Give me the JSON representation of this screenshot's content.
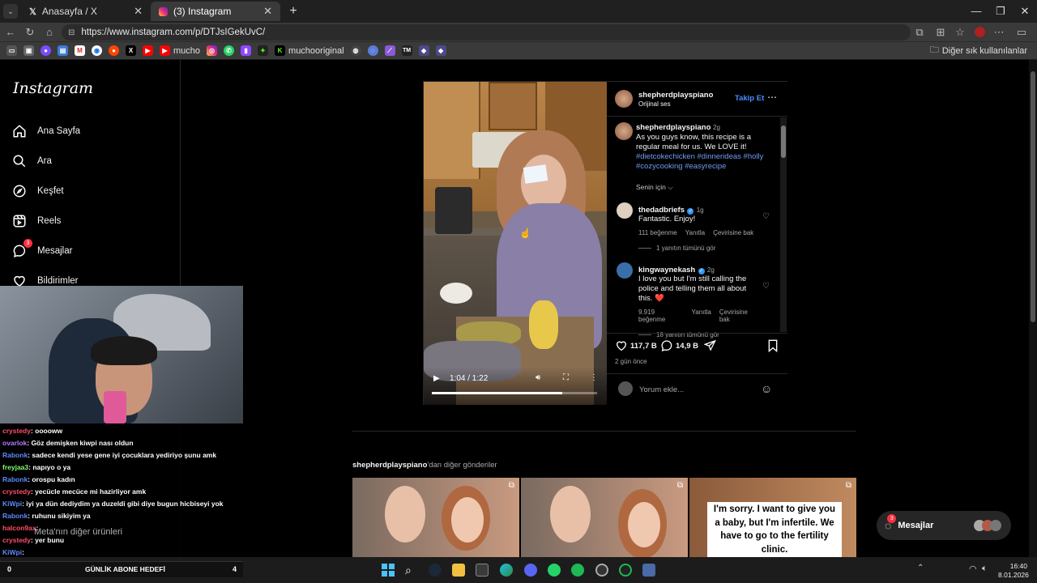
{
  "browser": {
    "tabs": [
      {
        "title": "Anasayfa / X",
        "icon": "x-logo-icon"
      },
      {
        "title": "(3) Instagram",
        "icon": "instagram-logo-icon"
      }
    ],
    "url": "https://www.instagram.com/p/DTJsIGekUvC/",
    "bookmarks": [
      "mucho",
      "muchooriginal"
    ],
    "bookmarks_other": "Diğer sık kullanılanlar"
  },
  "instagram": {
    "logo": "Instagram",
    "nav": [
      {
        "label": "Ana Sayfa",
        "icon": "home-icon"
      },
      {
        "label": "Ara",
        "icon": "search-icon"
      },
      {
        "label": "Keşfet",
        "icon": "compass-icon"
      },
      {
        "label": "Reels",
        "icon": "reels-icon"
      },
      {
        "label": "Mesajlar",
        "icon": "messenger-icon",
        "badge": "3"
      },
      {
        "label": "Bildirimler",
        "icon": "heart-icon"
      }
    ],
    "more_label": "Meta'nın diğer ürünleri",
    "post": {
      "author": "shepherdplayspiano",
      "audio": "Orijinal ses",
      "follow": "Takip Et",
      "caption_time": "2g",
      "caption": "As you guys know, this recipe is a regular meal for us. We LOVE it!",
      "hashtags": "#dietcokechicken #dinnerideas #holly #cozycooking #easyrecipe",
      "for_you": "Senin için",
      "video_time": "1:04 / 1:22",
      "video_progress": 0.79,
      "comments": [
        {
          "user": "thedadbriefs",
          "verified": true,
          "time": "1g",
          "text": "Fantastic. Enjoy!",
          "likes": "111 beğenme",
          "reply": "Yanıtla",
          "translate": "Çevirisine bak",
          "replies": "1 yanıtın tümünü gör"
        },
        {
          "user": "kingwaynekash",
          "verified": true,
          "time": "2g",
          "text": "I love you but I'm still calling the police and telling them all about this. ❤️",
          "likes": "9.919 beğenme",
          "reply": "Yanıtla",
          "translate": "Çevirisine bak",
          "replies": "18 yanıtın tümünü gör"
        }
      ],
      "like_count": "117,7 B",
      "comment_count": "14,9 B",
      "posted": "2 gün önce",
      "comment_placeholder": "Yorum ekle..."
    },
    "more_posts_user": "shepherdplayspiano",
    "more_posts_suffix": "'dan diğer gönderiler",
    "thumb_caption": "I'm sorry. I want to give you a baby, but I'm infertile. We have to go to the fertility clinic.",
    "messages_pill": {
      "label": "Mesajlar",
      "badge": "3"
    }
  },
  "stream": {
    "chat": [
      {
        "user": "crystedy",
        "color": "#ff4d6a",
        "msg": ": ooooww"
      },
      {
        "user": "ovarlok",
        "color": "#b47cff",
        "msg": ": Göz demişken kiwpi nası oldun"
      },
      {
        "user": "Rabonk",
        "color": "#5b8cff",
        "msg": ": sadece kendi yese gene iyi çocuklara yediriyo şunu amk"
      },
      {
        "user": "freyjaa3",
        "color": "#7cff6b",
        "msg": ": napıyo o ya"
      },
      {
        "user": "Rabonk",
        "color": "#5b8cff",
        "msg": ": orospu kadın"
      },
      {
        "user": "crystedy",
        "color": "#ff4d6a",
        "msg": ": yecücle mecüce mi hazirliyor amk"
      },
      {
        "user": "KiWpi",
        "color": "#5b8cff",
        "msg": ": iyi ya dün dediydim ya duzeldi gibi diye bugun hicbiseyi yok"
      },
      {
        "user": "Rabonk",
        "color": "#5b8cff",
        "msg": ": ruhunu sikiyim ya"
      },
      {
        "user": "halcon9ax",
        "color": "#ff4d6a",
        "msg": ": "
      },
      {
        "user": "crystedy",
        "color": "#ff4d6a",
        "msg": ": yer bunu"
      },
      {
        "user": "KiWpi",
        "color": "#5b8cff",
        "msg": ": "
      }
    ],
    "goal_left": "0",
    "goal_label": "GÜNLİK ABONE HEDEFİ",
    "goal_right": "4"
  },
  "taskbar": {
    "time": "16:40",
    "date": "8.01.2026"
  }
}
